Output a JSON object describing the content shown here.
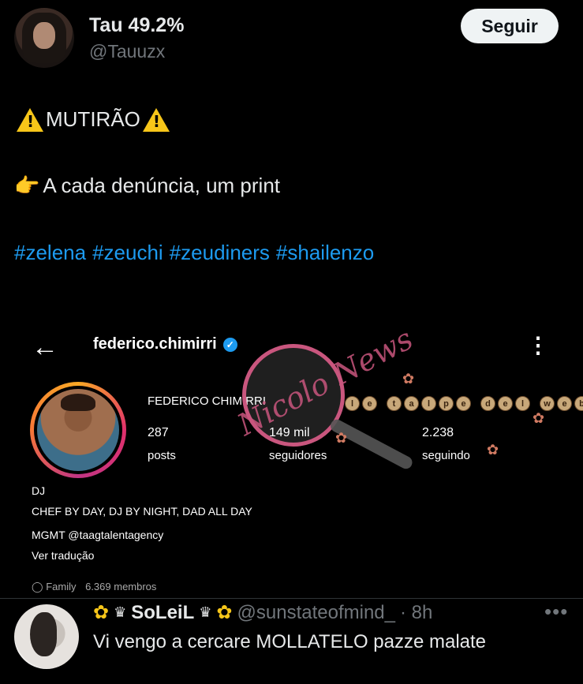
{
  "tweet": {
    "author_name": "Tau 49.2%",
    "author_handle": "@Tauuzx",
    "follow_label": "Seguir",
    "line1_text": "MUTIRÃO",
    "line2_emoji": "👉",
    "line2_text": "A cada denúncia, um print",
    "hashtags": [
      "#zelena",
      "#zeuchi",
      "#zeudiners",
      "#shailenzo"
    ]
  },
  "embedded_screenshot": {
    "username": "federico.chimirri",
    "full_name": "FEDERICO CHIMIRRI",
    "stats": [
      {
        "value": "287",
        "label": "posts"
      },
      {
        "value": "149 mil",
        "label": "seguidores"
      },
      {
        "value": "2.238",
        "label": "seguindo"
      }
    ],
    "category": "DJ",
    "bio_line": "CHEF BY DAY, DJ BY NIGHT, DAD ALL DAY",
    "mgmt_line": "MGMT @taagtalentagency",
    "translate_label": "Ver tradução",
    "family_label": "Family",
    "family_members": "6.369 membros",
    "watermark_text": "Nicolo News",
    "watermark_talpe": "le talpe del web"
  },
  "reply": {
    "name": "SoLeiL",
    "handle": "@sunstateofmind_",
    "time": "· 8h",
    "text": "Vi vengo a cercare MOLLATELO pazze malate",
    "more_label": "•••"
  },
  "colors": {
    "background": "#000000",
    "text": "#e7e9ea",
    "muted": "#71767b",
    "link": "#1d9bf0",
    "follow_bg": "#eff3f4",
    "warning": "#f7c619"
  },
  "icons": [
    "warning-icon",
    "pointing-hand-icon",
    "back-arrow-icon",
    "verified-icon",
    "more-vertical-icon",
    "sunflower-icon",
    "crown-icon",
    "more-horizontal-icon",
    "family-icon"
  ]
}
